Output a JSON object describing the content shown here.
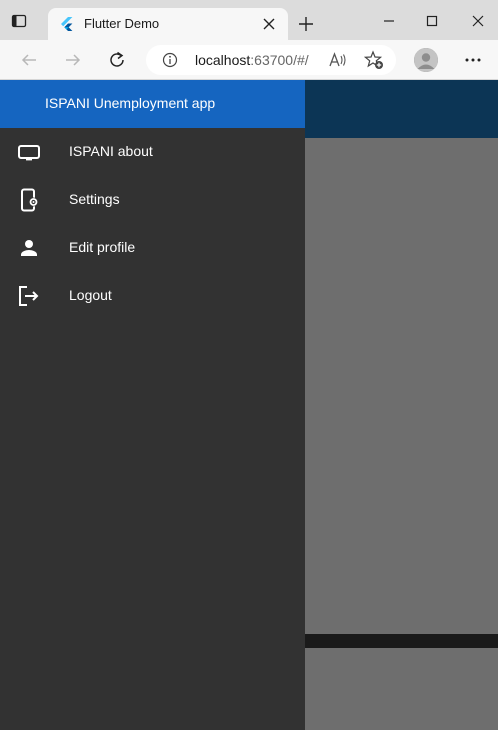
{
  "browser": {
    "tab_title": "Flutter Demo",
    "url_host": "localhost",
    "url_rest": ":63700/#/",
    "icons": {
      "tab_actions": "tab-actions-icon",
      "favicon": "flutter-logo-icon",
      "tab_close": "close-icon",
      "new_tab": "plus-icon",
      "minimize": "minimize-icon",
      "maximize": "maximize-icon",
      "window_close": "close-icon",
      "back": "arrow-left-icon",
      "forward": "arrow-right-icon",
      "refresh": "refresh-icon",
      "site_info": "info-icon",
      "read_aloud": "read-aloud-icon",
      "favorites": "star-add-icon",
      "profile": "profile-avatar-icon",
      "more": "more-horizontal-icon"
    }
  },
  "drawer": {
    "header_title": "ISPANI Unemployment app",
    "items": [
      {
        "label": "ISPANI about",
        "icon": "monitor-icon"
      },
      {
        "label": "Settings",
        "icon": "phone-settings-icon"
      },
      {
        "label": "Edit profile",
        "icon": "person-icon"
      },
      {
        "label": "Logout",
        "icon": "logout-icon"
      }
    ]
  },
  "colors": {
    "drawer_header": "#1565c0",
    "drawer_bg": "#323232",
    "app_bar": "#0c3555",
    "scrim": "#6e6e6e"
  }
}
